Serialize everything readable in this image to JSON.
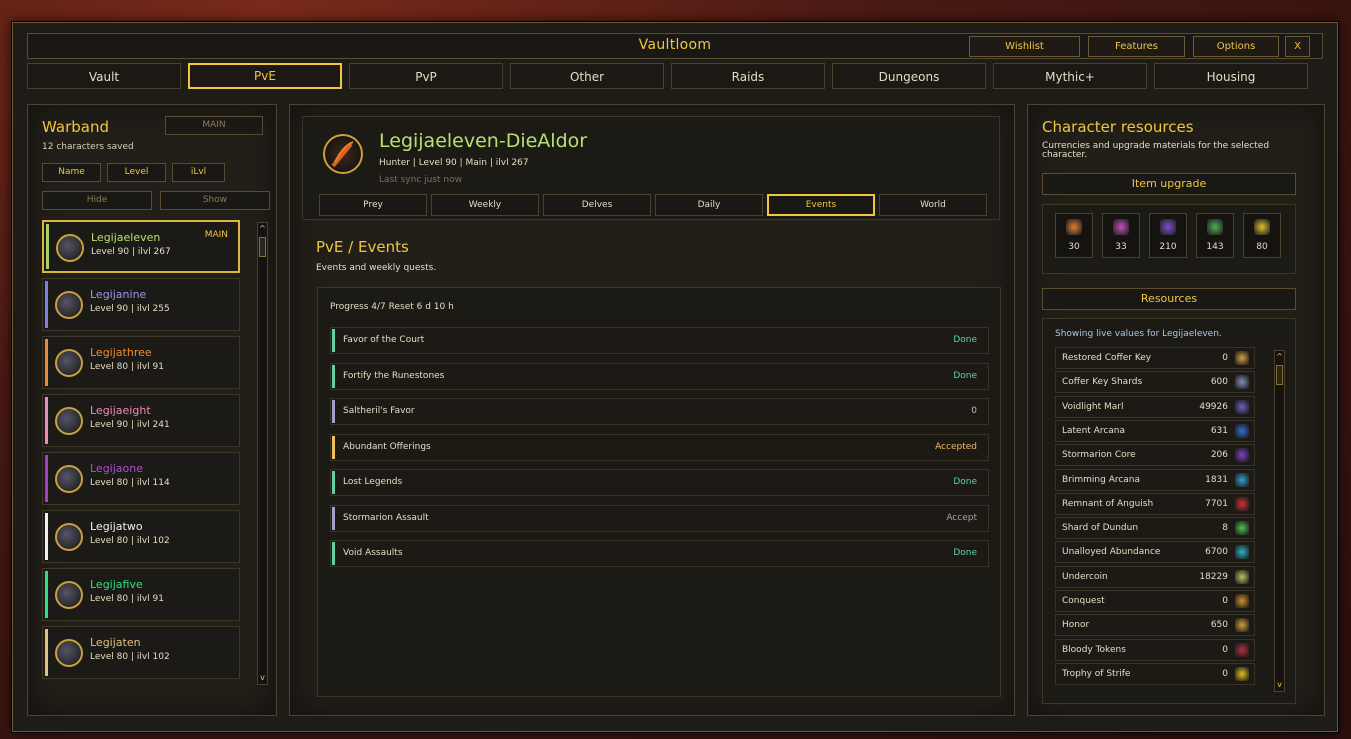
{
  "window": {
    "title": "Vaultloom",
    "buttons": [
      "Wishlist",
      "Features",
      "Options",
      "X"
    ]
  },
  "tabs": [
    "Vault",
    "PvE",
    "PvP",
    "Other",
    "Raids",
    "Dungeons",
    "Mythic+",
    "Housing"
  ],
  "active_tab": "PvE",
  "warband": {
    "title": "Warband",
    "main_button": "MAIN",
    "count_text": "12 characters saved",
    "sort_buttons": [
      "Name",
      "Level",
      "iLvl"
    ],
    "hide_label": "Hide",
    "show_label": "Show",
    "characters": [
      {
        "name": "Legijaeleven",
        "info": "Level 90  |  ilvl 267",
        "main": "MAIN",
        "color": "#b8e070",
        "bar": "#a8d060"
      },
      {
        "name": "Legijanine",
        "info": "Level 90  |  ilvl 255",
        "main": "",
        "color": "#9898f0",
        "bar": "#8080e0"
      },
      {
        "name": "Legijathree",
        "info": "Level 80  |  ilvl 91",
        "main": "",
        "color": "#f08a30",
        "bar": "#f08a30"
      },
      {
        "name": "Legijaeight",
        "info": "Level 90  |  ilvl 241",
        "main": "",
        "color": "#f08ab8",
        "bar": "#f08ab8"
      },
      {
        "name": "Legijaone",
        "info": "Level 80  |  ilvl 114",
        "main": "",
        "color": "#b050d0",
        "bar": "#a040c8"
      },
      {
        "name": "Legijatwo",
        "info": "Level 80  |  ilvl 102",
        "main": "",
        "color": "#f0f0f0",
        "bar": "#f0f0f0"
      },
      {
        "name": "Legijafive",
        "info": "Level 80  |  ilvl 91",
        "main": "",
        "color": "#30e080",
        "bar": "#30e080"
      },
      {
        "name": "Legijaten",
        "info": "Level 80  |  ilvl 102",
        "main": "",
        "color": "#e0c080",
        "bar": "#e0c080"
      }
    ]
  },
  "character": {
    "name": "Legijaeleven-DieAldor",
    "info": "Hunter  |  Level 90  |  Main  |  ilvl 267",
    "sync": "Last sync just now",
    "subtabs": [
      "Prey",
      "Weekly",
      "Delves",
      "Daily",
      "Events",
      "World"
    ],
    "active_subtab": "Events"
  },
  "section": {
    "title": "PvE / Events",
    "subtitle": "Events and weekly quests.",
    "progress": "Progress  4/7      Reset  6 d 10 h",
    "quests": [
      {
        "name": "Favor of the Court",
        "status": "Done",
        "color": "#60d0a0",
        "bar": "#60d0a0"
      },
      {
        "name": "Fortify the Runestones",
        "status": "Done",
        "color": "#60d0a0",
        "bar": "#60d0a0"
      },
      {
        "name": "Saltheril's Favor",
        "status": "0",
        "color": "#c8c0b0",
        "bar": "#a0a0c8"
      },
      {
        "name": "Abundant Offerings",
        "status": "Accepted",
        "color": "#f0b860",
        "bar": "#f0c060"
      },
      {
        "name": "Lost Legends",
        "status": "Done",
        "color": "#60d0a0",
        "bar": "#60d0a0"
      },
      {
        "name": "Stormarion Assault",
        "status": "Accept",
        "color": "#a0a0b8",
        "bar": "#a0a0c8"
      },
      {
        "name": "Void Assaults",
        "status": "Done",
        "color": "#60d0a0",
        "bar": "#60d0a0"
      }
    ]
  },
  "resources": {
    "title": "Character resources",
    "subtitle": "Currencies and upgrade materials for the selected character.",
    "item_upgrade_label": "Item upgrade",
    "upgrades": [
      {
        "value": "30",
        "color": "#e08030"
      },
      {
        "value": "33",
        "color": "#c050c0"
      },
      {
        "value": "210",
        "color": "#8050d0"
      },
      {
        "value": "143",
        "color": "#50b050"
      },
      {
        "value": "80",
        "color": "#e0c030"
      }
    ],
    "resources_label": "Resources",
    "note": "Showing live values for Legijaeleven.",
    "items": [
      {
        "name": "Restored Coffer Key",
        "value": "0",
        "color": "#d0a040"
      },
      {
        "name": "Coffer Key Shards",
        "value": "600",
        "color": "#8090b0"
      },
      {
        "name": "Voidlight Marl",
        "value": "49926",
        "color": "#7060c0"
      },
      {
        "name": "Latent Arcana",
        "value": "631",
        "color": "#3070d0"
      },
      {
        "name": "Stormarion Core",
        "value": "206",
        "color": "#8040c0"
      },
      {
        "name": "Brimming Arcana",
        "value": "1831",
        "color": "#30a0d0"
      },
      {
        "name": "Remnant of Anguish",
        "value": "7701",
        "color": "#d03030"
      },
      {
        "name": "Shard of Dundun",
        "value": "8",
        "color": "#50c050"
      },
      {
        "name": "Unalloyed Abundance",
        "value": "6700",
        "color": "#30b0c0"
      },
      {
        "name": "Undercoin",
        "value": "18229",
        "color": "#c0c060"
      },
      {
        "name": "Conquest",
        "value": "0",
        "color": "#d09030"
      },
      {
        "name": "Honor",
        "value": "650",
        "color": "#d0a030"
      },
      {
        "name": "Bloody Tokens",
        "value": "0",
        "color": "#b03040"
      },
      {
        "name": "Trophy of Strife",
        "value": "0",
        "color": "#e0c020"
      }
    ]
  }
}
